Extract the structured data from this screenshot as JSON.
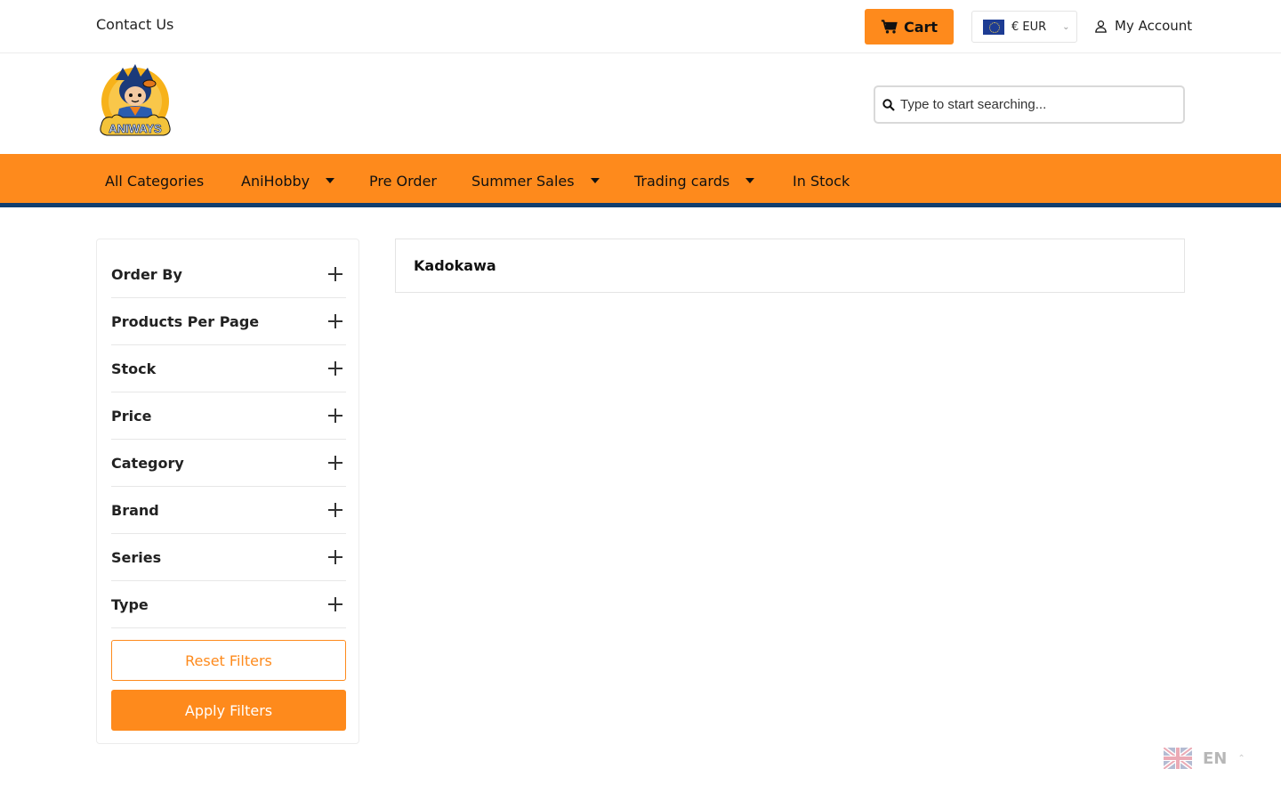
{
  "topbar": {
    "contact_label": "Contact Us",
    "cart_label": "Cart",
    "currency_label": "€ EUR",
    "account_label": "My Account"
  },
  "header": {
    "logo_text": "ANIWAYS",
    "search_placeholder": "Type to start searching..."
  },
  "nav": {
    "items": [
      {
        "label": "All Categories",
        "has_dropdown": false
      },
      {
        "label": "AniHobby",
        "has_dropdown": true
      },
      {
        "label": "Pre Order",
        "has_dropdown": false
      },
      {
        "label": "Summer Sales",
        "has_dropdown": true
      },
      {
        "label": "Trading cards",
        "has_dropdown": true
      },
      {
        "label": "In Stock",
        "has_dropdown": false
      }
    ]
  },
  "filters": {
    "items": [
      {
        "label": "Order By"
      },
      {
        "label": "Products Per Page"
      },
      {
        "label": "Stock"
      },
      {
        "label": "Price"
      },
      {
        "label": "Category"
      },
      {
        "label": "Brand"
      },
      {
        "label": "Series"
      },
      {
        "label": "Type"
      }
    ],
    "reset_label": "Reset Filters",
    "apply_label": "Apply Filters"
  },
  "main": {
    "brand_title": "Kadokawa"
  },
  "language": {
    "code": "EN"
  },
  "colors": {
    "accent": "#fe8a1c",
    "nav_border": "#113e6e"
  }
}
